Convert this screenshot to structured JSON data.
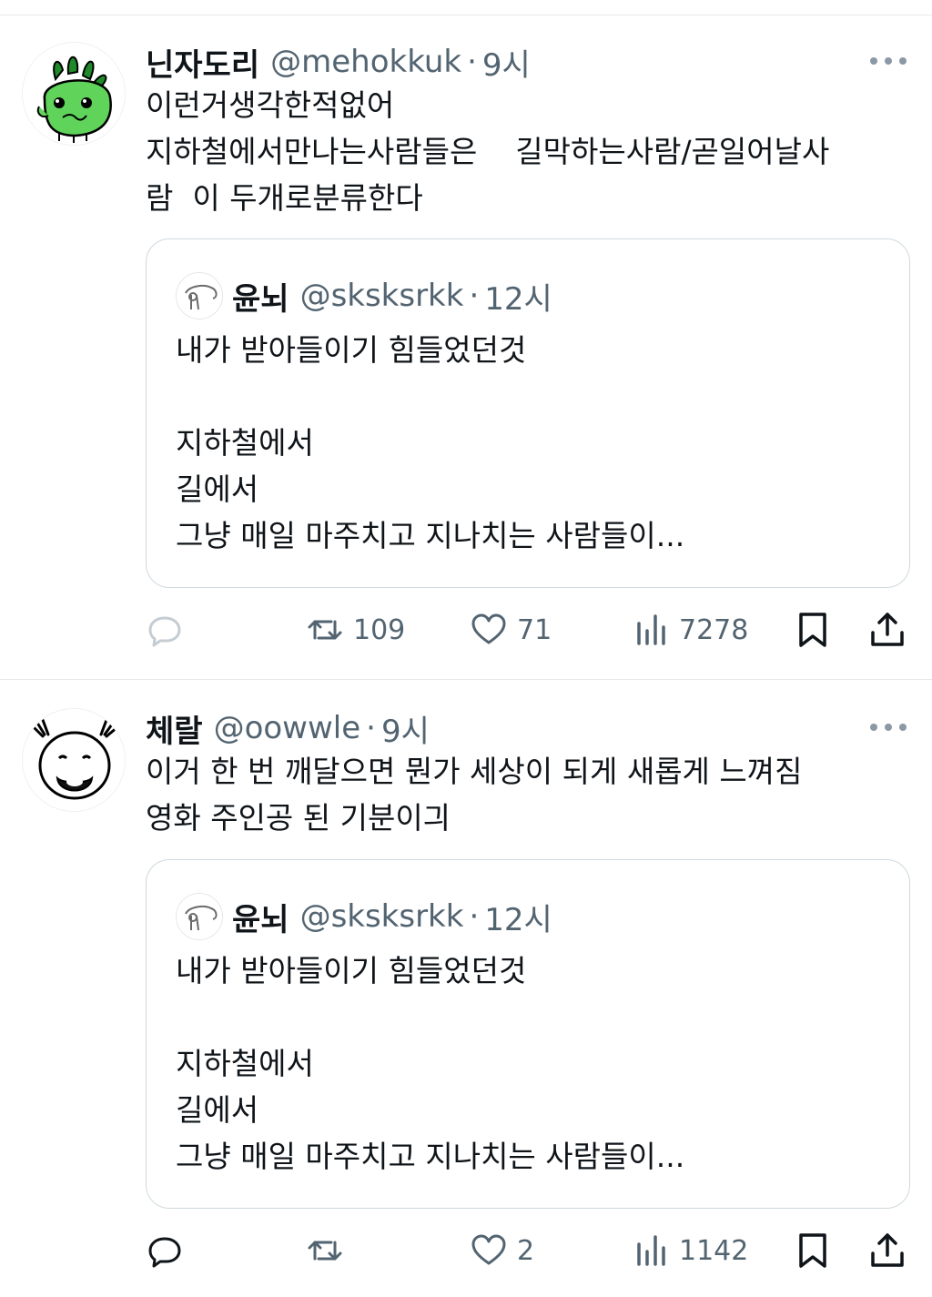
{
  "tweets": [
    {
      "name": "닌자도리",
      "handle": "@mehokkuk",
      "sep": "·",
      "time": "9시",
      "text": "이런거생각한적없어\n지하철에서만나는사람들은    길막하는사람/곧일어날사\n람  이 두개로분류한다",
      "quote": {
        "name": "윤뇌",
        "handle": "@sksksrkk",
        "sep": "·",
        "time": "12시",
        "text": "내가 받아들이기 힘들었던것\n\n지하철에서\n길에서\n그냥 매일 마주치고 지나치는 사람들이..."
      },
      "stats": {
        "reply": "",
        "retweet": "109",
        "like": "71",
        "views": "7278"
      }
    },
    {
      "name": "체랄",
      "handle": "@oowwle",
      "sep": "·",
      "time": "9시",
      "text": "이거 한 번 깨달으면 뭔가 세상이 되게 새롭게 느껴짐\n영화 주인공 된 기분이긔",
      "quote": {
        "name": "윤뇌",
        "handle": "@sksksrkk",
        "sep": "·",
        "time": "12시",
        "text": "내가 받아들이기 힘들었던것\n\n지하철에서\n길에서\n그냥 매일 마주치고 지나치는 사람들이..."
      },
      "stats": {
        "reply": "",
        "retweet": "",
        "like": "2",
        "views": "1142"
      }
    }
  ],
  "icons": {
    "reply": "reply-icon",
    "retweet": "retweet-icon",
    "like": "heart-icon",
    "views": "views-icon",
    "bookmark": "bookmark-icon",
    "share": "share-icon",
    "more": "more-dots-icon"
  },
  "colors": {
    "text": "#0f1419",
    "muted": "#536471",
    "border": "#cfd9de",
    "avatar_green": "#4cbb3f"
  }
}
